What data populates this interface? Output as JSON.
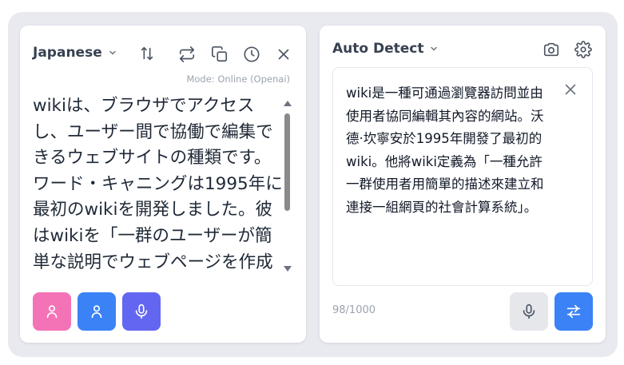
{
  "source_panel": {
    "language": "Japanese",
    "mode": "Mode: Online (Openai)",
    "text": "wikiは、ブラウザでアクセスし、ユーザー間で協働で編集できるウェブサイトの種類です。ワード・キャニングは1995年に最初のwikiを開発しました。彼はwikiを「一群のユーザーが簡単な説明でウェブページを作成し",
    "icons": [
      "swap-vertical-icon",
      "swap-arrows-icon",
      "copy-icon",
      "history-icon",
      "close-icon"
    ],
    "buttons": [
      {
        "name": "female-voice-button",
        "icon": "person-icon",
        "color": "#f472b6"
      },
      {
        "name": "male-voice-button",
        "icon": "person-icon",
        "color": "#3b82f6"
      },
      {
        "name": "microphone-button",
        "icon": "microphone-icon",
        "color": "#6366f1"
      }
    ]
  },
  "target_panel": {
    "language": "Auto Detect",
    "text": "wiki是一種可通過瀏覽器訪問並由使用者協同編輯其內容的網站。沃德·坎寧安於1995年開發了最初的wiki。他將wiki定義為「一種允許一群使用者用簡單的描述來建立和連接一組網頁的社會計算系統」。",
    "char_count": "98/1000",
    "icons": [
      "camera-icon",
      "gear-icon",
      "clear-icon"
    ],
    "buttons": [
      {
        "name": "microphone-button",
        "icon": "microphone-icon",
        "color": "#e5e7eb"
      },
      {
        "name": "translate-button",
        "icon": "translate-icon",
        "color": "#3b82f6"
      }
    ]
  }
}
